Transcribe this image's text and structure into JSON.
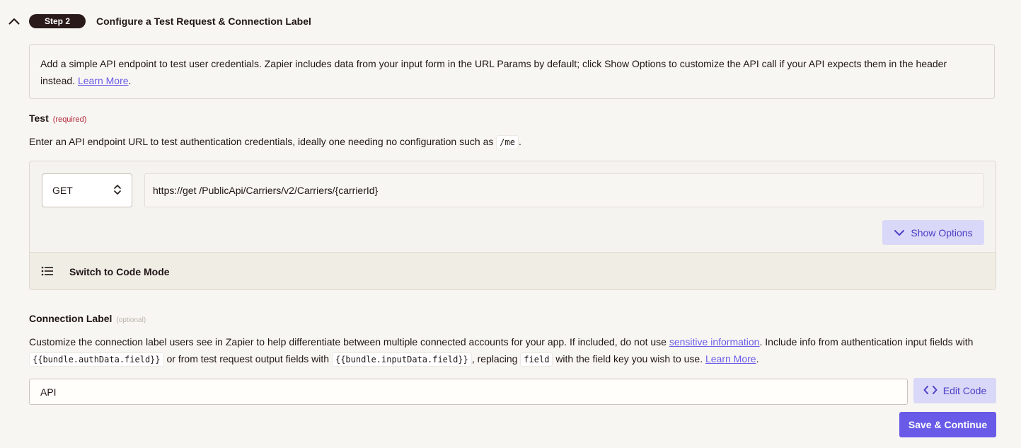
{
  "step": {
    "badge": "Step 2",
    "title": "Configure a Test Request & Connection Label"
  },
  "intro": {
    "text": "Add a simple API endpoint to test user credentials. Zapier includes data from your input form in the URL Params by default; click Show Options to customize the API call if your API expects them in the header instead.",
    "link": "Learn More",
    "trailing": "."
  },
  "test": {
    "label": "Test",
    "required": "(required)",
    "desc_before": "Enter an API endpoint URL to test authentication credentials, ideally one needing no configuration such as",
    "desc_code": "/me",
    "desc_after": ".",
    "method": "GET",
    "url": "https://get /PublicApi/Carriers/v2/Carriers/{carrierId}",
    "show_options": "Show Options",
    "switch_code": "Switch to Code Mode"
  },
  "connection": {
    "label": "Connection Label",
    "optional": "(optional)",
    "p1": "Customize the connection label users see in Zapier to help differentiate between multiple connected accounts for your app. If included, do not use",
    "link_sensitive": "sensitive information",
    "p2": ". Include info from authentication input fields with",
    "code1": "{{bundle.authData.field}}",
    "p3": "or from test request output fields with",
    "code2": "{{bundle.inputData.field}}",
    "p4": ", replacing",
    "code3": "field",
    "p5": "with the field key you wish to use.",
    "link_learn": "Learn More",
    "p6": ".",
    "value": "API",
    "edit_code": "Edit Code"
  },
  "save_button": "Save & Continue",
  "colors": {
    "accent": "#695be8",
    "accent_light": "#dad8f8",
    "badge_bg": "#2b1a1a",
    "required": "#b3263b"
  },
  "icons": {
    "collapse": "chevron-up-icon",
    "method_select": "up-down-chevron-icon",
    "show_options": "chevron-down-icon",
    "code_mode": "list-icon",
    "edit_code": "code-brackets-icon"
  }
}
